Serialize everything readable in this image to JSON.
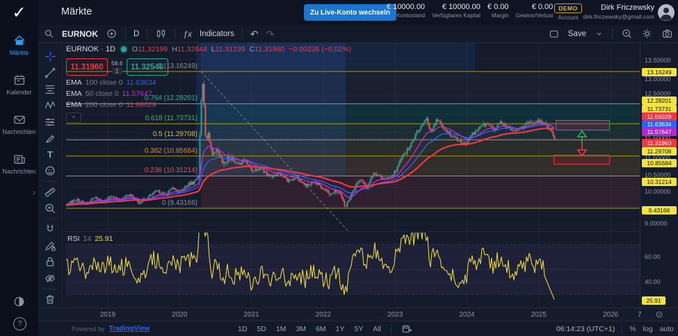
{
  "top_bar": {
    "title": "Märkte",
    "live_button": "Zu Live-Konto wechseln",
    "stats": [
      {
        "value": "€ 10000.00",
        "label": "Kontostand"
      },
      {
        "value": "€ 10000.00",
        "label": "Verfügbares Kapital"
      },
      {
        "value": "€ 0.00",
        "label": "Margin"
      },
      {
        "value": "€ 0.00",
        "label": "Gewinn/Verlust"
      }
    ],
    "account_badge": "DEMO",
    "account_label": "Account",
    "user_name": "Dirk Friczewsky",
    "user_email": "dirk.friczewsky@gmail.com"
  },
  "sidebar": {
    "items": [
      {
        "label": "Märkte",
        "icon": "home",
        "active": true
      },
      {
        "label": "Kalender",
        "icon": "calendar",
        "active": false
      },
      {
        "label": "Nachrichten",
        "icon": "mail",
        "active": false
      },
      {
        "label": "Nachrichten",
        "icon": "news",
        "active": false
      }
    ]
  },
  "chart_toolbar": {
    "symbol": "EURNOK",
    "interval": "D",
    "indicators_label": "Indicators",
    "save_label": "Save"
  },
  "draw_toolbar": {
    "tools": [
      "crosshair",
      "trend-line",
      "fib-retracement",
      "xabcd-pattern",
      "forecast",
      "brush",
      "text",
      "emoji",
      "ruler",
      "zoom-in",
      "magnet",
      "drawing-lock",
      "lock-all",
      "hide-drawings",
      "remove-objects"
    ]
  },
  "legend": {
    "symbol_title": "EURNOK · 1D",
    "ohlc": {
      "o": "11.32199",
      "h": "11.32844",
      "l": "11.31239",
      "c": "11.31960",
      "change": "−0.00236 (−0.02%)"
    },
    "bid": "11.31960",
    "spread": "58.6",
    "qty": "1",
    "ask": "11.32546",
    "emas": [
      {
        "name": "EMA",
        "params": "100 close 0",
        "value": "11.63634",
        "color": "#2962ff"
      },
      {
        "name": "EMA",
        "params": "50 close 0",
        "value": "11.57647",
        "color": "#c02bd8"
      },
      {
        "name": "EMA",
        "params": "200 close 0",
        "value": "11.66029",
        "color": "#f23645"
      }
    ],
    "rsi_label": "RSI",
    "rsi_params": "14",
    "rsi_value": "25.91"
  },
  "time_axis": {
    "years": [
      "2019",
      "2020",
      "2021",
      "2022",
      "2023",
      "2024",
      "2025",
      "2026"
    ],
    "partial_label": "7"
  },
  "bottom_bar": {
    "powered_by": "Powered by",
    "provider": "TradingView",
    "ranges": [
      "1D",
      "5D",
      "1M",
      "3M",
      "6M",
      "1Y",
      "5Y",
      "All"
    ],
    "clock": "06:14:23 (UTC+1)",
    "scale_percent": "%",
    "scale_log": "log",
    "scale_auto": "auto"
  },
  "chart_data": {
    "type": "candlestick",
    "symbol": "EURNOK",
    "interval": "1D",
    "ohlc_last": {
      "open": 11.32199,
      "high": 11.32844,
      "low": 11.31239,
      "close": 11.3196,
      "change": -0.00236,
      "change_pct": "−0.02%"
    },
    "bid": 11.3196,
    "ask": 11.32546,
    "spread_points": "58.6",
    "price_anchors": [
      [
        2018.42,
        9.52
      ],
      [
        2018.55,
        9.68
      ],
      [
        2018.68,
        9.55
      ],
      [
        2018.82,
        9.72
      ],
      [
        2018.95,
        9.62
      ],
      [
        2019.05,
        9.78
      ],
      [
        2019.15,
        9.65
      ],
      [
        2019.3,
        9.8
      ],
      [
        2019.42,
        9.58
      ],
      [
        2019.55,
        9.73
      ],
      [
        2019.68,
        9.9
      ],
      [
        2019.8,
        9.8
      ],
      [
        2019.9,
        9.97
      ],
      [
        2020.0,
        9.88
      ],
      [
        2020.1,
        10.05
      ],
      [
        2020.2,
        10.15
      ],
      [
        2020.26,
        10.35
      ],
      [
        2020.31,
        13.16
      ],
      [
        2020.36,
        11.2
      ],
      [
        2020.4,
        11.5
      ],
      [
        2020.45,
        10.8
      ],
      [
        2020.52,
        10.95
      ],
      [
        2020.6,
        10.6
      ],
      [
        2020.7,
        10.85
      ],
      [
        2020.8,
        10.62
      ],
      [
        2020.9,
        10.75
      ],
      [
        2021.0,
        10.45
      ],
      [
        2021.12,
        10.55
      ],
      [
        2021.25,
        10.3
      ],
      [
        2021.38,
        10.42
      ],
      [
        2021.5,
        10.18
      ],
      [
        2021.62,
        10.28
      ],
      [
        2021.75,
        10.05
      ],
      [
        2021.88,
        10.12
      ],
      [
        2022.0,
        9.98
      ],
      [
        2022.12,
        9.82
      ],
      [
        2022.2,
        9.95
      ],
      [
        2022.3,
        9.44
      ],
      [
        2022.4,
        9.9
      ],
      [
        2022.5,
        10.22
      ],
      [
        2022.6,
        10.0
      ],
      [
        2022.7,
        10.42
      ],
      [
        2022.8,
        10.28
      ],
      [
        2022.9,
        10.22
      ],
      [
        2023.0,
        10.45
      ],
      [
        2023.1,
        10.85
      ],
      [
        2023.2,
        11.1
      ],
      [
        2023.3,
        11.5
      ],
      [
        2023.42,
        11.9
      ],
      [
        2023.5,
        11.52
      ],
      [
        2023.58,
        11.85
      ],
      [
        2023.68,
        11.62
      ],
      [
        2023.78,
        11.42
      ],
      [
        2023.88,
        11.3
      ],
      [
        2023.97,
        11.18
      ],
      [
        2024.07,
        11.45
      ],
      [
        2024.17,
        11.62
      ],
      [
        2024.27,
        11.75
      ],
      [
        2024.37,
        11.55
      ],
      [
        2024.47,
        11.8
      ],
      [
        2024.57,
        11.62
      ],
      [
        2024.67,
        11.52
      ],
      [
        2024.77,
        11.66
      ],
      [
        2024.87,
        11.76
      ],
      [
        2024.97,
        11.82
      ],
      [
        2025.05,
        11.76
      ],
      [
        2025.12,
        11.66
      ],
      [
        2025.18,
        11.5
      ],
      [
        2025.215,
        11.33
      ]
    ],
    "fib_retracement": {
      "high": 13.16249,
      "low": 9.43166,
      "levels": [
        {
          "ratio": "1",
          "price": "13.16249",
          "color": "#8c8f99"
        },
        {
          "ratio": "0.764",
          "price": "12.28201",
          "color": "#2ab5a0"
        },
        {
          "ratio": "0.618",
          "price": "11.73731",
          "color": "#3fae7a"
        },
        {
          "ratio": "0.5",
          "price": "11.29708",
          "color": "#cfc03a"
        },
        {
          "ratio": "0.382",
          "price": "10.85684",
          "color": "#d08a39"
        },
        {
          "ratio": "0.236",
          "price": "10.31214",
          "color": "#e25959"
        },
        {
          "ratio": "0",
          "price": "9.43166",
          "color": "#8c8f99"
        }
      ]
    },
    "emas": [
      {
        "length": 100,
        "value": 11.63634
      },
      {
        "length": 50,
        "value": 11.57647
      },
      {
        "length": 200,
        "value": 11.66029
      }
    ],
    "rsi": {
      "length": 14,
      "last": 25.91,
      "upper": 70,
      "lower": 30
    },
    "price_axis": {
      "plain": [
        [
          "13.50000",
          87
        ],
        [
          "13.00000",
          114
        ],
        [
          "12.50000",
          135
        ],
        [
          "11.50000",
          199
        ],
        [
          "11.00000",
          228
        ],
        [
          "10.50000",
          252
        ],
        [
          "10.00000",
          276
        ],
        [
          "9.00000",
          322
        ],
        [
          "60.00",
          370
        ],
        [
          "40.00",
          406
        ]
      ],
      "badges": [
        [
          "13.16249",
          104,
          "fib"
        ],
        [
          "12.28201",
          145,
          "fib"
        ],
        [
          "11.73731",
          157,
          "fib"
        ],
        [
          "11.66029",
          168,
          "ema200"
        ],
        [
          "11.63634",
          179,
          "ema100"
        ],
        [
          "11.57647",
          190,
          "ema50"
        ],
        [
          "11.31960",
          206,
          "price"
        ],
        [
          "11.29708",
          218,
          "fib"
        ],
        [
          "10.85684",
          235,
          "fib"
        ],
        [
          "10.31214",
          262,
          "fib"
        ],
        [
          "9.43166",
          303,
          "fib"
        ],
        [
          "25.91",
          433,
          "fib"
        ]
      ]
    },
    "colors": {
      "up": "#26a69a",
      "down": "#ef5350",
      "fib_line": "#a89b10",
      "fib_badge": "#f2e43c",
      "ema50": "#c02bd8",
      "ema100": "#2962ff",
      "ema200": "#f23645",
      "price_line": "#f23645",
      "rsi_line": "#ecd93c",
      "accent": "#2f9bf6"
    }
  }
}
